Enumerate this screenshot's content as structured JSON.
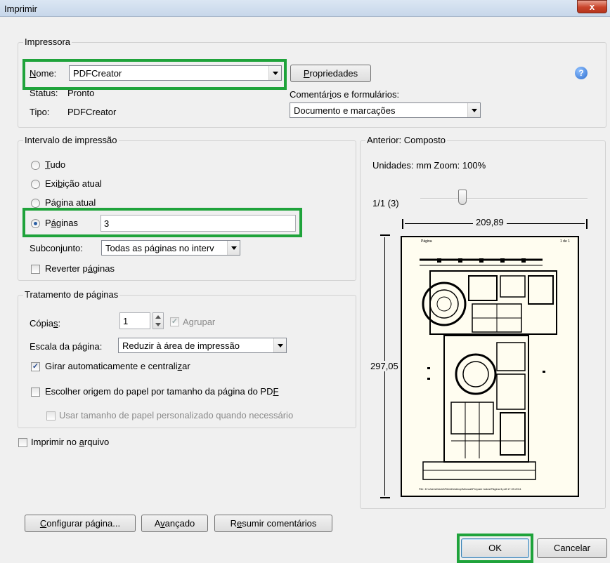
{
  "window": {
    "title": "Imprimir",
    "close_glyph": "x"
  },
  "printer": {
    "group_label": "Impressora",
    "name_label": "Nome:",
    "name_value": "PDFCreator",
    "properties_button": "Propriedades",
    "status_label": "Status:",
    "status_value": "Pronto",
    "type_label": "Tipo:",
    "type_value": "PDFCreator",
    "comments_label": "Comentários e formulários:",
    "comments_value": "Documento e marcações"
  },
  "range": {
    "group_label": "Intervalo de impressão",
    "options": [
      "Tudo",
      "Exibição atual",
      "Página atual",
      "Páginas"
    ],
    "pages_value": "3",
    "subset_label": "Subconjunto:",
    "subset_value": "Todas as páginas no interv",
    "reverse_label": "Reverter páginas"
  },
  "handling": {
    "group_label": "Tratamento de páginas",
    "copies_label": "Cópias:",
    "copies_value": "1",
    "collate_label": "Agrupar",
    "scale_label": "Escala da página:",
    "scale_value": "Reduzir à área de impressão",
    "auto_rotate_label": "Girar automaticamente e centralizar",
    "paper_source_label": "Escolher origem do papel por tamanho da página do PDF",
    "custom_paper_label": "Usar tamanho de papel personalizado quando necessário"
  },
  "print_to_file_label": "Imprimir no arquivo",
  "preview": {
    "header": "Anterior: Composto",
    "units": "Unidades: mm Zoom: 100%",
    "page_counter": "1/1 (3)",
    "width": "209,89",
    "height": "297,05",
    "sheet_header_left": "Página",
    "sheet_header_right": "1 de 1",
    "sheet_footer": "File: D:\\Users\\David\\Files\\Desktop\\Manual\\Prepare todos\\Página 3.pdf   17.09.2011"
  },
  "buttons": {
    "page_setup": "Configurar página...",
    "advanced": "Avançado",
    "summarize": "Resumir comentários",
    "ok": "OK",
    "cancel": "Cancelar"
  },
  "colors": {
    "highlight": "#1fa33b",
    "help": "#2f6fcf"
  }
}
